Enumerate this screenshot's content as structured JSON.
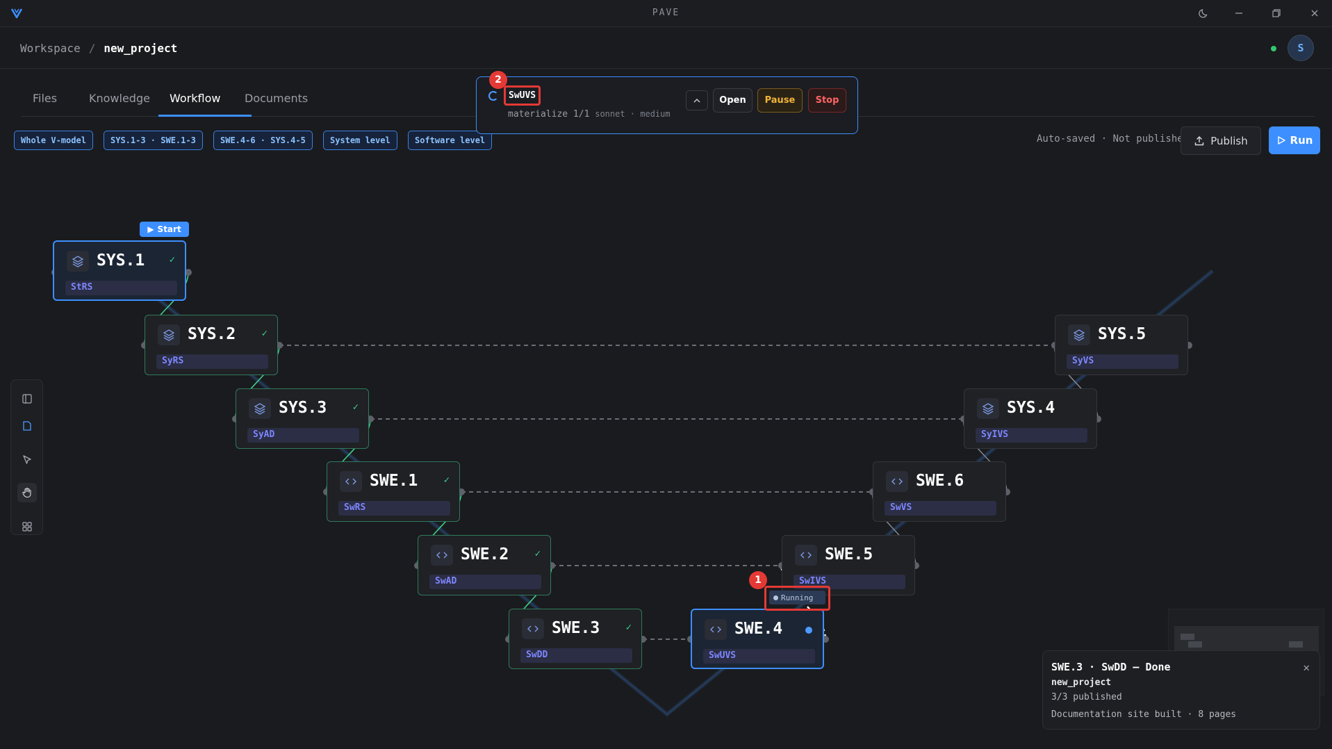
{
  "app": {
    "title": "PAVE"
  },
  "breadcrumb": {
    "root": "Workspace",
    "separator": "/",
    "current": "new_project"
  },
  "user": {
    "initial": "S",
    "status_color": "#33c772"
  },
  "tabs": [
    {
      "label": "Files"
    },
    {
      "label": "Knowledge"
    },
    {
      "label": "Workflow",
      "active": true
    },
    {
      "label": "Documents"
    }
  ],
  "filters": [
    {
      "label": "Whole V-model"
    },
    {
      "label": "SYS.1-3 · SWE.1-3"
    },
    {
      "label": "SWE.4-6 · SYS.4-5"
    },
    {
      "label": "System level"
    },
    {
      "label": "Software level"
    }
  ],
  "toolbar": {
    "autosave": "Auto-saved · Not published",
    "publish_label": "Publish",
    "run_label": "Run"
  },
  "run_panel": {
    "name": "SwUVS",
    "task": "materialize 1/1",
    "meta": "sonnet · medium",
    "open_label": "Open",
    "pause_label": "Pause",
    "stop_label": "Stop"
  },
  "badges": {
    "first": "1",
    "second": "2"
  },
  "canvas": {
    "start_label": "Start",
    "running_label": "Running",
    "nodes": [
      {
        "id": "SYS.1",
        "artifact": "StRS",
        "status": "done",
        "icon": "layers-icon"
      },
      {
        "id": "SYS.2",
        "artifact": "SyRS",
        "status": "done",
        "icon": "layers-icon"
      },
      {
        "id": "SYS.3",
        "artifact": "SyAD",
        "status": "done",
        "icon": "layers-icon"
      },
      {
        "id": "SWE.1",
        "artifact": "SwRS",
        "status": "done",
        "icon": "code-icon"
      },
      {
        "id": "SWE.2",
        "artifact": "SwAD",
        "status": "done",
        "icon": "code-icon"
      },
      {
        "id": "SWE.3",
        "artifact": "SwDD",
        "status": "done",
        "icon": "code-icon"
      },
      {
        "id": "SWE.4",
        "artifact": "SwUVS",
        "status": "running",
        "icon": "code-icon"
      },
      {
        "id": "SWE.5",
        "artifact": "SwIVS",
        "status": "pending",
        "icon": "code-icon"
      },
      {
        "id": "SWE.6",
        "artifact": "SwVS",
        "status": "pending",
        "icon": "code-icon"
      },
      {
        "id": "SYS.4",
        "artifact": "SyIVS",
        "status": "pending",
        "icon": "layers-icon"
      },
      {
        "id": "SYS.5",
        "artifact": "SyVS",
        "status": "pending",
        "icon": "layers-icon"
      }
    ]
  },
  "toast": {
    "title": "SWE.3 · SwDD — Done",
    "project": "new_project",
    "published": "3/3 published",
    "detail": "Documentation site built · 8 pages"
  },
  "colors": {
    "accent": "#3d8fff",
    "done_border": "#2f7a5c",
    "check": "#3fcf8e",
    "danger": "#e53935",
    "warning": "#f0b33a"
  }
}
